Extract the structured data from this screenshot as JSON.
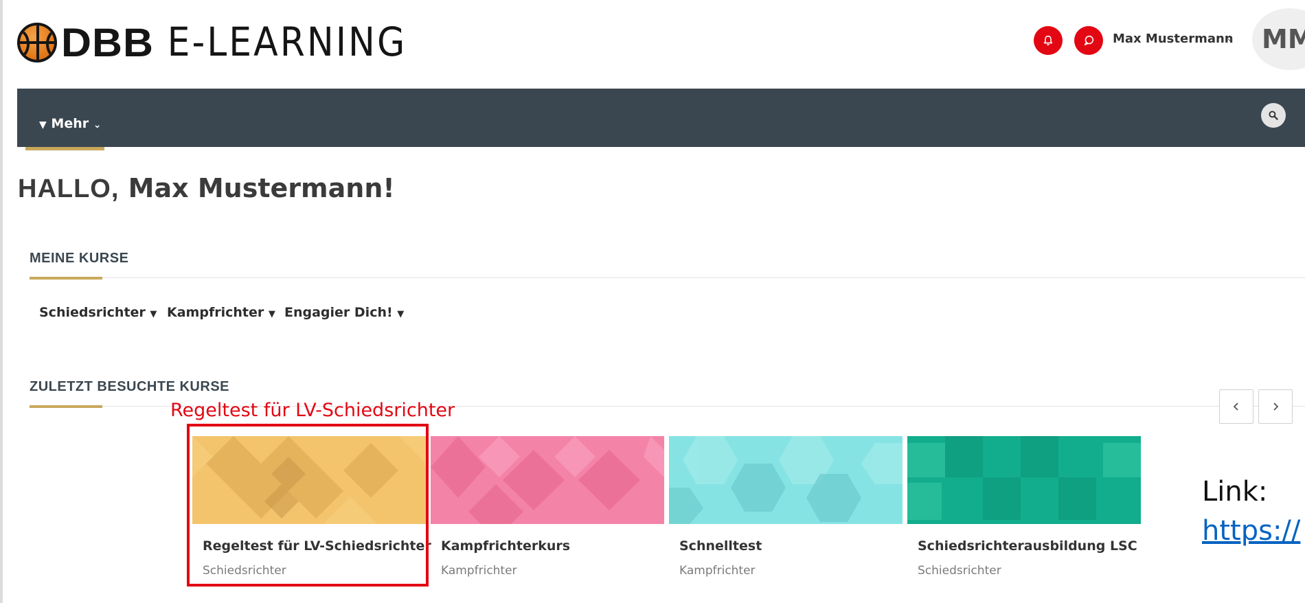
{
  "header": {
    "logo_bold": "DBB",
    "logo_thin": "E-LEARNING",
    "user_name": "Max Mustermann",
    "avatar_initials": "MM"
  },
  "nav": {
    "more_label": "Mehr"
  },
  "greeting": {
    "hallo": "HALLO,",
    "name": "Max Mustermann!"
  },
  "my_courses": {
    "title": "MEINE KURSE",
    "filters": [
      "Schiedsrichter",
      "Kampfrichter",
      "Engagier Dich!"
    ]
  },
  "recent_courses": {
    "title": "ZULETZT BESUCHTE KURSE",
    "cards": [
      {
        "title": "Regeltest für LV-Schiedsrichter",
        "category": "Schiedsrichter",
        "color": "#f3c46c"
      },
      {
        "title": "Kampfrichterkurs",
        "category": "Kampfrichter",
        "color": "#f483a8"
      },
      {
        "title": "Schnelltest",
        "category": "Kampfrichter",
        "color": "#86e3e4"
      },
      {
        "title": "Schiedsrichterausbildung LSC",
        "category": "Schiedsrichter",
        "color": "#12ad8c"
      }
    ]
  },
  "annotation": {
    "label": "Regeltest für LV-Schiedsrichter",
    "link_label": "Link:",
    "link_url": "https://"
  },
  "colors": {
    "accent": "#c9a85c",
    "navbar": "#3b4750",
    "brand_red": "#e30613"
  }
}
